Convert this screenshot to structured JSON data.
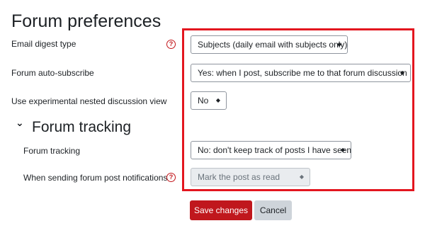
{
  "page": {
    "title": "Forum preferences"
  },
  "rows": {
    "email_digest": {
      "label": "Email digest type",
      "help": "?",
      "value": "Subjects (daily email with subjects only)"
    },
    "auto_subscribe": {
      "label": "Forum auto-subscribe",
      "value": "Yes: when I post, subscribe me to that forum discussion"
    },
    "nested_view": {
      "label": "Use experimental nested discussion view",
      "value": "No"
    }
  },
  "tracking_section": {
    "title": "Forum tracking",
    "chevron": "⌄",
    "forum_tracking": {
      "label": "Forum tracking",
      "value": "No: don't keep track of posts I have seen"
    },
    "notifications": {
      "label": "When sending forum post notifications",
      "help": "?",
      "value": "Mark the post as read"
    }
  },
  "buttons": {
    "save": "Save changes",
    "cancel": "Cancel"
  },
  "select_arrow_glyph": "◆",
  "colors": {
    "highlight": "#e3161f",
    "primary": "#c0171d",
    "help": "#c3161b",
    "secondary": "#ced4da"
  },
  "icons": {
    "help": "question-circle-icon",
    "chevron": "chevron-down-icon",
    "select_arrows": "select-arrows-icon"
  }
}
